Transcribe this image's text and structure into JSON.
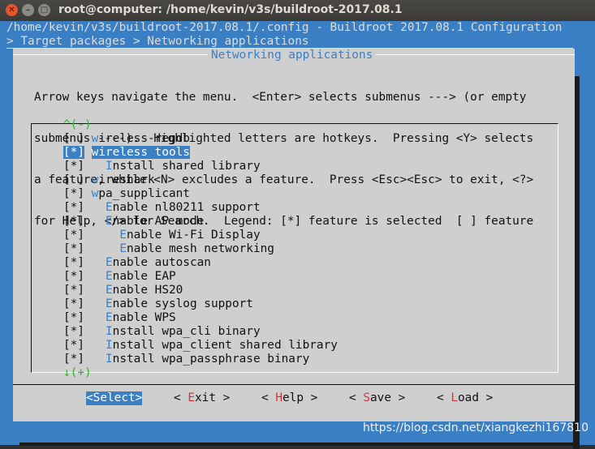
{
  "window": {
    "title": "root@computer: /home/kevin/v3s/buildroot-2017.08.1"
  },
  "header": {
    "line1": "/home/kevin/v3s/buildroot-2017.08.1/.config - Buildroot 2017.08.1 Configuration",
    "line2": "> Target packages > Networking applications"
  },
  "dialog": {
    "title": "Networking applications",
    "help_lines": [
      "Arrow keys navigate the menu.  <Enter> selects submenus ---> (or empty",
      "submenus ----).  Highlighted letters are hotkeys.  Pressing <Y> selects",
      "a feature, while <N> excludes a feature.  Press <Esc><Esc> to exit, <?>",
      "for Help, </> for Search.  Legend: [*] feature is selected  [ ] feature"
    ],
    "top_indicator": "^(-)",
    "bottom_indicator": "↓(+)"
  },
  "menu_items": [
    {
      "check": "[ ]",
      "indent": "",
      "hot": "w",
      "rest": "ireless-regdb",
      "selected": false
    },
    {
      "check": "[*]",
      "indent": "",
      "hot": "w",
      "rest": "ireless tools",
      "selected": true
    },
    {
      "check": "[*]",
      "indent": "  ",
      "hot": "I",
      "rest": "nstall shared library",
      "selected": false
    },
    {
      "check": "[ ]",
      "indent": "",
      "hot": "w",
      "rest": "ireshark",
      "selected": false
    },
    {
      "check": "[*]",
      "indent": "",
      "hot": "w",
      "rest": "pa_supplicant",
      "selected": false
    },
    {
      "check": "[*]",
      "indent": "  ",
      "hot": "E",
      "rest": "nable nl80211 support",
      "selected": false
    },
    {
      "check": "[*]",
      "indent": "  ",
      "hot": "E",
      "rest": "nable AP mode",
      "selected": false
    },
    {
      "check": "[*]",
      "indent": "    ",
      "hot": "E",
      "rest": "nable Wi-Fi Display",
      "selected": false
    },
    {
      "check": "[*]",
      "indent": "    ",
      "hot": "E",
      "rest": "nable mesh networking",
      "selected": false
    },
    {
      "check": "[*]",
      "indent": "  ",
      "hot": "E",
      "rest": "nable autoscan",
      "selected": false
    },
    {
      "check": "[*]",
      "indent": "  ",
      "hot": "E",
      "rest": "nable EAP",
      "selected": false
    },
    {
      "check": "[*]",
      "indent": "  ",
      "hot": "E",
      "rest": "nable HS20",
      "selected": false
    },
    {
      "check": "[*]",
      "indent": "  ",
      "hot": "E",
      "rest": "nable syslog support",
      "selected": false
    },
    {
      "check": "[*]",
      "indent": "  ",
      "hot": "E",
      "rest": "nable WPS",
      "selected": false
    },
    {
      "check": "[*]",
      "indent": "  ",
      "hot": "I",
      "rest": "nstall wpa_cli binary",
      "selected": false
    },
    {
      "check": "[*]",
      "indent": "  ",
      "hot": "I",
      "rest": "nstall wpa_client shared library",
      "selected": false
    },
    {
      "check": "[*]",
      "indent": "  ",
      "hot": "I",
      "rest": "nstall wpa_passphrase binary",
      "selected": false
    }
  ],
  "buttons": [
    {
      "pre": "<",
      "hot": "S",
      "rest": "elect>",
      "selected": true
    },
    {
      "pre": "< ",
      "hot": "E",
      "rest": "xit >",
      "selected": false
    },
    {
      "pre": "< ",
      "hot": "H",
      "rest": "elp >",
      "selected": false
    },
    {
      "pre": "< ",
      "hot": "S",
      "rest": "ave >",
      "selected": false
    },
    {
      "pre": "< ",
      "hot": "L",
      "rest": "oad >",
      "selected": false
    }
  ],
  "watermark": "https://blog.csdn.net/xiangkezhi167810"
}
